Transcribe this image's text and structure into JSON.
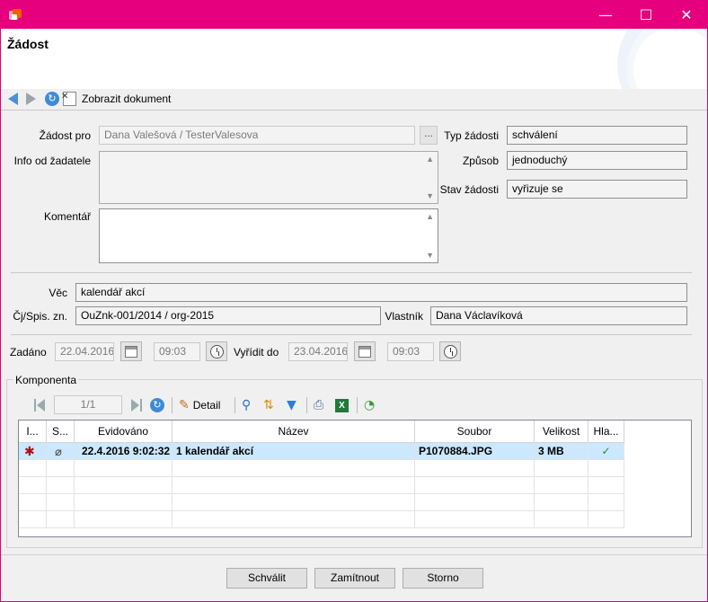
{
  "window": {
    "minimize_glyph": "—",
    "maximize_glyph": "☐",
    "close_glyph": "✕",
    "accent_color": "#e6007e"
  },
  "header": {
    "title": "Žádost"
  },
  "toolbar": {
    "show_document_label": "Zobrazit dokument"
  },
  "form": {
    "request_for_label": "Žádost pro",
    "request_for_value": "Dana Valešová / TesterValesova",
    "ellipsis": "...",
    "applicant_info_label": "Info od žadatele",
    "comment_label": "Komentář",
    "request_type_label": "Typ žádosti",
    "request_type_value": "schválení",
    "method_label": "Způsob",
    "method_value": "jednoduchý",
    "status_label": "Stav žádosti",
    "status_value": "vyřizuje se",
    "subject_label": "Věc",
    "subject_value": "kalendář akcí",
    "ref_label": "Čj/Spis. zn.",
    "ref_value": "OuZnk-001/2014 / org-2015",
    "owner_label": "Vlastník",
    "owner_value": "Dana Václavíková",
    "assigned_label": "Zadáno",
    "assigned_date": "22.04.2016",
    "assigned_time": "09:03",
    "due_label": "Vyřídit do",
    "due_date": "23.04.2016",
    "due_time": "09:03"
  },
  "component": {
    "title": "Komponenta",
    "pager": "1/1",
    "detail_label": "Detail",
    "columns": [
      "I...",
      "S...",
      "Evidováno",
      "Název",
      "Soubor",
      "Velikost",
      "Hla..."
    ],
    "rows": [
      {
        "registered": "22.4.2016 9:02:32",
        "name": "1 kalendář akcí",
        "file": "P1070884.JPG",
        "size": "3 MB",
        "main": "✓"
      }
    ]
  },
  "buttons": {
    "approve": "Schválit",
    "reject": "Zamítnout",
    "cancel": "Storno"
  }
}
